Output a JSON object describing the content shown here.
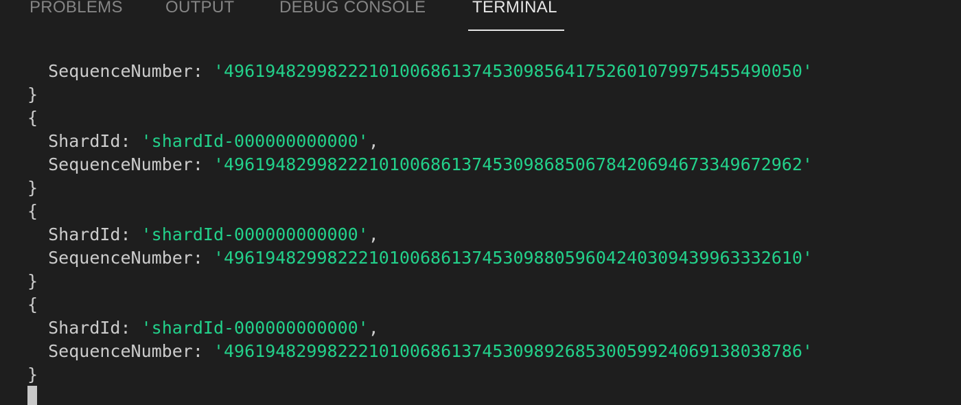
{
  "panel": {
    "tabs": [
      {
        "label": "PROBLEMS"
      },
      {
        "label": "OUTPUT"
      },
      {
        "label": "DEBUG CONSOLE"
      },
      {
        "label": "TERMINAL"
      }
    ],
    "active_tab": "TERMINAL"
  },
  "terminal": {
    "lines": {
      "l0": {
        "key": "SequenceNumber:",
        "value": "'49619482998222101006861374530985641752601079975455490050'"
      },
      "l1": "}",
      "l2": "{",
      "l3": {
        "key": "ShardId:",
        "value": "'shardId-000000000000'",
        "trail": ","
      },
      "l4": {
        "key": "SequenceNumber:",
        "value": "'49619482998222101006861374530986850678420694673349672962'"
      },
      "l5": "}",
      "l6": "{",
      "l7": {
        "key": "ShardId:",
        "value": "'shardId-000000000000'",
        "trail": ","
      },
      "l8": {
        "key": "SequenceNumber:",
        "value": "'49619482998222101006861374530988059604240309439963332610'"
      },
      "l9": "}",
      "l10": "{",
      "l11": {
        "key": "ShardId:",
        "value": "'shardId-000000000000'",
        "trail": ","
      },
      "l12": {
        "key": "SequenceNumber:",
        "value": "'49619482998222101006861374530989268530059924069138038786'"
      },
      "l13": "}"
    }
  },
  "colors": {
    "background": "#1e1e1e",
    "string": "#23d18b",
    "text": "#cccccc",
    "tab_inactive": "#858585",
    "tab_active": "#e7e7e7"
  }
}
